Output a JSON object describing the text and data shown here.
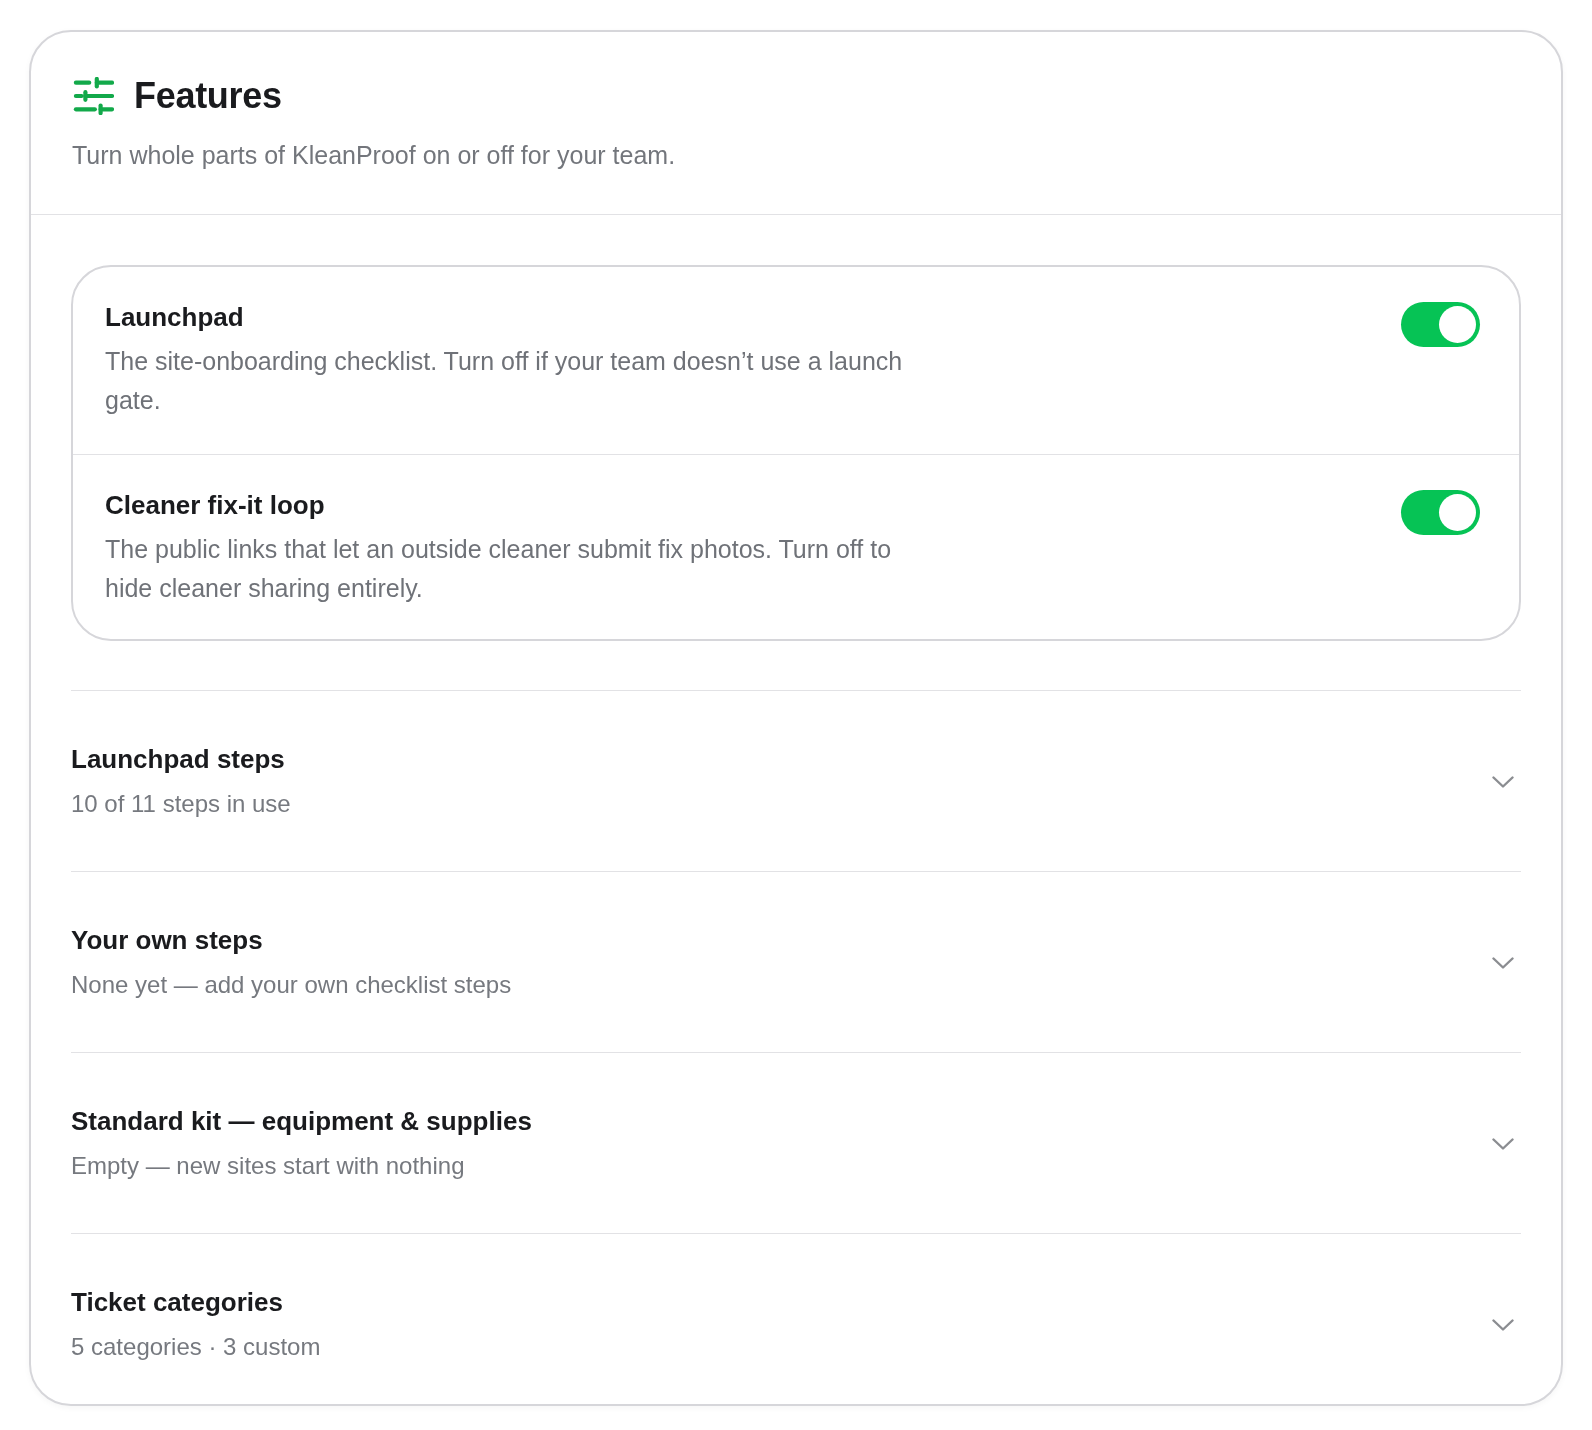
{
  "header": {
    "title": "Features",
    "subtitle": "Turn whole parts of KleanProof on or off for your team."
  },
  "features": [
    {
      "name": "Launchpad",
      "description": "The site-onboarding checklist. Turn off if your team doesn’t use a launch gate.",
      "on": true
    },
    {
      "name": "Cleaner fix-it loop",
      "description": "The public links that let an outside cleaner submit fix photos. Turn off to hide cleaner sharing entirely.",
      "on": true
    }
  ],
  "sections": [
    {
      "title": "Launchpad steps",
      "summary": "10 of 11 steps in use",
      "expanded": false
    },
    {
      "title": "Your own steps",
      "summary": "None yet — add your own checklist steps",
      "expanded": false
    },
    {
      "title": "Standard kit — equipment & supplies",
      "summary": "Empty — new sites start with nothing",
      "expanded": false
    },
    {
      "title": "Ticket categories",
      "summary": "5 categories · 3 custom",
      "expanded": false
    }
  ]
}
